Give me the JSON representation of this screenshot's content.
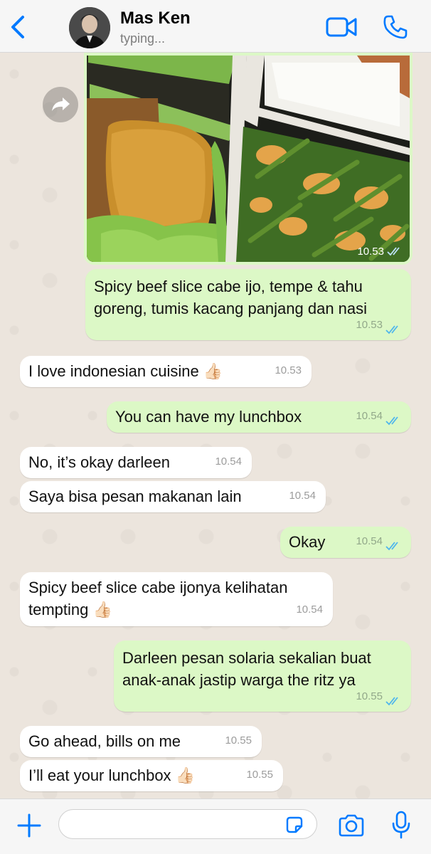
{
  "header": {
    "contact_name": "Mas Ken",
    "status": "typing..."
  },
  "image_message": {
    "time": "10.53",
    "read": true
  },
  "messages": [
    {
      "dir": "out",
      "text_lines": [
        "Spicy beef slice cabe ijo, tempe & tahu",
        "goreng, tumis kacang panjang dan nasi"
      ],
      "time": "10.53",
      "read": true
    },
    {
      "dir": "in",
      "text": "I love indonesian cuisine",
      "emoji": "👍🏻",
      "time": "10.53"
    },
    {
      "dir": "out",
      "text": "You can have my lunchbox",
      "time": "10.54",
      "read": true
    },
    {
      "dir": "in",
      "text": "No, it’s okay darleen",
      "time": "10.54"
    },
    {
      "dir": "in",
      "text": "Saya bisa pesan makanan lain",
      "time": "10.54"
    },
    {
      "dir": "out",
      "text": "Okay",
      "time": "10.54",
      "read": true
    },
    {
      "dir": "in",
      "text_lines": [
        "Spicy beef slice cabe ijonya kelihatan",
        "tempting"
      ],
      "emoji": "👍🏻",
      "time": "10.54"
    },
    {
      "dir": "out",
      "text_lines": [
        "Darleen pesan solaria sekalian buat",
        "anak-anak jastip warga the ritz ya"
      ],
      "time": "10.55",
      "read": true
    },
    {
      "dir": "in",
      "text": "Go ahead, bills on me",
      "time": "10.55"
    },
    {
      "dir": "in",
      "text": "I’ll eat your lunchbox",
      "emoji": "👍🏻",
      "time": "10.55"
    }
  ],
  "footer": {
    "input_value": "",
    "input_placeholder": ""
  },
  "colors": {
    "accent_blue": "#007aff",
    "outgoing_bubble": "#dcf8c6",
    "incoming_bubble": "#ffffff",
    "read_tick": "#4fb6ec",
    "chat_background": "#ece5dd"
  },
  "icons": [
    "back-chevron-icon",
    "avatar",
    "video-call-icon",
    "phone-icon",
    "forward-icon",
    "double-tick-icon",
    "plus-icon",
    "sticker-icon",
    "camera-icon",
    "microphone-icon"
  ]
}
